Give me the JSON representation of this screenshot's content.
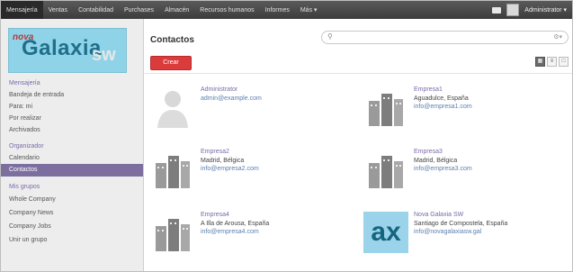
{
  "topbar": {
    "nav": [
      "Mensajería",
      "Ventas",
      "Contabilidad",
      "Purchases",
      "Almacén",
      "Recursos humanos",
      "Informes",
      "Más ▾"
    ],
    "user": "Administrator ▾"
  },
  "sidebar": {
    "logo": {
      "prefix": "nova",
      "main": "Galaxia",
      "suffix": "sw"
    },
    "sections": [
      {
        "title": "Mensajería",
        "items": [
          "Bandeja de entrada",
          "Para: mi",
          "Por realizar",
          "Archivados"
        ]
      },
      {
        "title": "Organizador",
        "items": [
          "Calendario",
          "Contactos"
        ]
      },
      {
        "title": "Mis grupos",
        "items": [
          "Whole Company",
          "Company News",
          "Company Jobs",
          "Unir un grupo"
        ]
      }
    ]
  },
  "main": {
    "title": "Contactos",
    "search_placeholder": "",
    "create_label": "Crear"
  },
  "contacts": [
    {
      "name": "Administrator",
      "location": "",
      "email": "admin@example.com",
      "image": "person-placeholder"
    },
    {
      "name": "Empresa1",
      "location": "Aguadulce, España",
      "email": "info@empresa1.com",
      "image": "company-buildings"
    },
    {
      "name": "Empresa2",
      "location": "Madrid, Bélgica",
      "email": "info@empresa2.com",
      "image": "company-buildings"
    },
    {
      "name": "Empresa3",
      "location": "Madrid, Bélgica",
      "email": "info@empresa3.com",
      "image": "company-buildings"
    },
    {
      "name": "Empresa4",
      "location": "A Illa de Arousa, España",
      "email": "info@empresa4.com",
      "image": "company-buildings"
    },
    {
      "name": "Nova Galaxia SW",
      "location": "Santiago de Compostela, España",
      "email": "info@novagalaxiasw.gal",
      "image": "ax-logo",
      "logo_text": "ax"
    }
  ],
  "colors": {
    "accent": "#7c6fa0",
    "create_button": "#dc3b3b",
    "topbar": "#3c3c3c",
    "link": "#5b7fb0"
  }
}
